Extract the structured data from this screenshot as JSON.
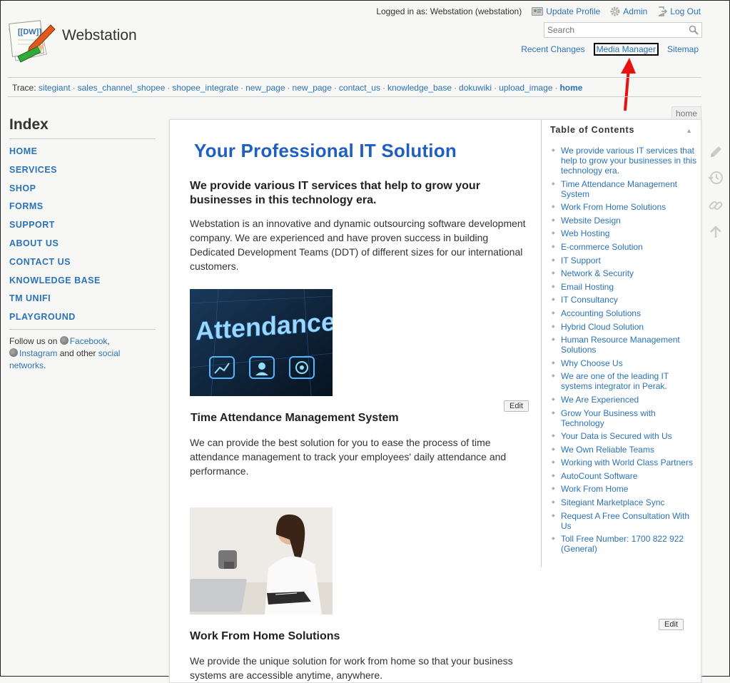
{
  "user": {
    "logged_in_text": "Logged in as: Webstation (webstation)",
    "update_profile": "Update Profile",
    "admin": "Admin",
    "log_out": "Log Out"
  },
  "site": {
    "title": "Webstation",
    "logo_text": "[[DW]]"
  },
  "search": {
    "placeholder": "Search",
    "value": ""
  },
  "site_tools": {
    "recent_changes": "Recent Changes",
    "media_manager": "Media Manager",
    "sitemap": "Sitemap"
  },
  "trace": {
    "label": "Trace:",
    "separator": "·",
    "items": [
      "sitegiant",
      "sales_channel_shopee",
      "shopee_integrate",
      "new_page",
      "new_page",
      "contact_us",
      "knowledge_base",
      "dokuwiki",
      "upload_image"
    ],
    "current": "home"
  },
  "sidebar": {
    "title": "Index",
    "items": [
      "HOME",
      "SERVICES",
      "SHOP",
      "FORMS",
      "SUPPORT",
      "ABOUT US",
      "CONTACT US",
      "KNOWLEDGE BASE",
      "TM UNIFI",
      "PLAYGROUND"
    ],
    "follow": {
      "text1": "Follow us on",
      "facebook": "Facebook",
      "comma": ",",
      "instagram": "Instagram",
      "text2": "and other",
      "social": "social networks",
      "period": "."
    }
  },
  "page": {
    "tab": "home",
    "title": "Your Professional IT Solution",
    "lead": "We provide various IT services that help to grow your businesses in this technology era.",
    "intro": "Webstation is an innovative and dynamic outsourcing software development company. We are experienced and have proven success in building Dedicated Development Teams (DDT) of different sizes for our international customers.",
    "image1_text": "Attendance",
    "section1": {
      "edit": "Edit",
      "heading": "Time Attendance Management System",
      "text": "We can provide the best solution for you to ease the process of time attendance management to track your employees' daily attendance and performance."
    },
    "section2": {
      "edit": "Edit",
      "heading": "Work From Home Solutions",
      "text": "We provide the unique solution for work from home so that your business systems are accessible anytime, anywhere."
    }
  },
  "toc": {
    "title": "Table of Contents",
    "items": [
      "We provide various IT services that help to grow your businesses in this technology era.",
      "Time Attendance Management System",
      "Work From Home Solutions",
      "Website Design",
      "Web Hosting",
      "E-commerce Solution",
      "IT Support",
      "Network & Security",
      "Email Hosting",
      "IT Consultancy",
      "Accounting Solutions",
      "Hybrid Cloud Solution",
      "Human Resource Management Solutions",
      "Why Choose Us",
      "We are one of the leading IT systems integrator in Perak.",
      "We Are Experienced",
      "Grow Your Business with Technology",
      "Your Data is Secured with Us",
      "We Own Reliable Teams",
      "Working with World Class Partners",
      "AutoCount Software",
      "Work From Home",
      "Sitegiant Marketplace Sync",
      "Request A Free Consultation With Us",
      "Toll Free Number: 1700 822 922 (General)"
    ]
  },
  "colors": {
    "link": "#2b73b7",
    "title_blue": "#1e5fbf",
    "annotation_arrow": "#e81010"
  },
  "icons": [
    "profile-icon",
    "gear-icon",
    "logout-icon",
    "search-icon",
    "edit-pencil-icon",
    "history-icon",
    "link-icon",
    "back-to-top-icon",
    "globe-icon"
  ]
}
